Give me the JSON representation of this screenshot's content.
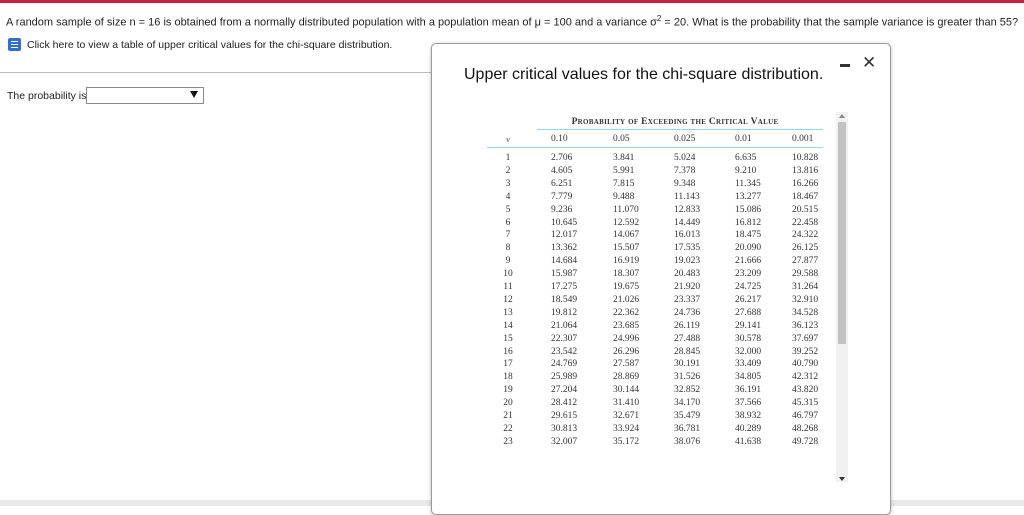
{
  "question": {
    "before_sigma": "A random sample of size n = 16 is obtained from a normally distributed population with a  population mean of μ = 100 and a variance σ",
    "sup": "2",
    "after_sigma": " = 20. What is the probability that the sample variance is greater than 55?"
  },
  "help_link": "Click here to view a table of upper critical values for the chi-square distribution.",
  "answer": {
    "label": "The probability is",
    "value": ""
  },
  "dialog": {
    "title": "Upper critical values for the chi-square distribution.",
    "minimize_icon": "minimize-icon",
    "close_glyph": "✕"
  },
  "table": {
    "caption": "Probability of Exceeding the Critical Value",
    "nu_label": "ν",
    "columns": [
      "0.10",
      "0.05",
      "0.025",
      "0.01",
      "0.001"
    ],
    "rows": [
      [
        "1",
        "2.706",
        "3.841",
        "5.024",
        "6.635",
        "10.828"
      ],
      [
        "2",
        "4.605",
        "5.991",
        "7.378",
        "9.210",
        "13.816"
      ],
      [
        "3",
        "6.251",
        "7.815",
        "9.348",
        "11.345",
        "16.266"
      ],
      [
        "4",
        "7.779",
        "9.488",
        "11.143",
        "13.277",
        "18.467"
      ],
      [
        "5",
        "9.236",
        "11.070",
        "12.833",
        "15.086",
        "20.515"
      ],
      [
        "6",
        "10.645",
        "12.592",
        "14.449",
        "16.812",
        "22.458"
      ],
      [
        "7",
        "12.017",
        "14.067",
        "16.013",
        "18.475",
        "24.322"
      ],
      [
        "8",
        "13.362",
        "15.507",
        "17.535",
        "20.090",
        "26.125"
      ],
      [
        "9",
        "14.684",
        "16.919",
        "19.023",
        "21.666",
        "27.877"
      ],
      [
        "10",
        "15.987",
        "18.307",
        "20.483",
        "23.209",
        "29.588"
      ],
      [
        "11",
        "17.275",
        "19.675",
        "21.920",
        "24.725",
        "31.264"
      ],
      [
        "12",
        "18.549",
        "21.026",
        "23.337",
        "26.217",
        "32.910"
      ],
      [
        "13",
        "19.812",
        "22.362",
        "24.736",
        "27.688",
        "34.528"
      ],
      [
        "14",
        "21.064",
        "23.685",
        "26.119",
        "29.141",
        "36.123"
      ],
      [
        "15",
        "22.307",
        "24.996",
        "27.488",
        "30.578",
        "37.697"
      ],
      [
        "16",
        "23.542",
        "26.296",
        "28.845",
        "32.000",
        "39.252"
      ],
      [
        "17",
        "24.769",
        "27.587",
        "30.191",
        "33.409",
        "40.790"
      ],
      [
        "18",
        "25.989",
        "28.869",
        "31.526",
        "34.805",
        "42.312"
      ],
      [
        "19",
        "27.204",
        "30.144",
        "32.852",
        "36.191",
        "43.820"
      ],
      [
        "20",
        "28.412",
        "31.410",
        "34.170",
        "37.566",
        "45.315"
      ],
      [
        "21",
        "29.615",
        "32.671",
        "35.479",
        "38.932",
        "46.797"
      ],
      [
        "22",
        "30.813",
        "33.924",
        "36.781",
        "40.289",
        "48.268"
      ],
      [
        "23",
        "32.007",
        "35.172",
        "38.076",
        "41.638",
        "49.728"
      ]
    ]
  },
  "colors": {
    "accent_bar": "#c8203d",
    "table_rule": "#9fd3e3",
    "book_icon": "#2f6fd1"
  }
}
